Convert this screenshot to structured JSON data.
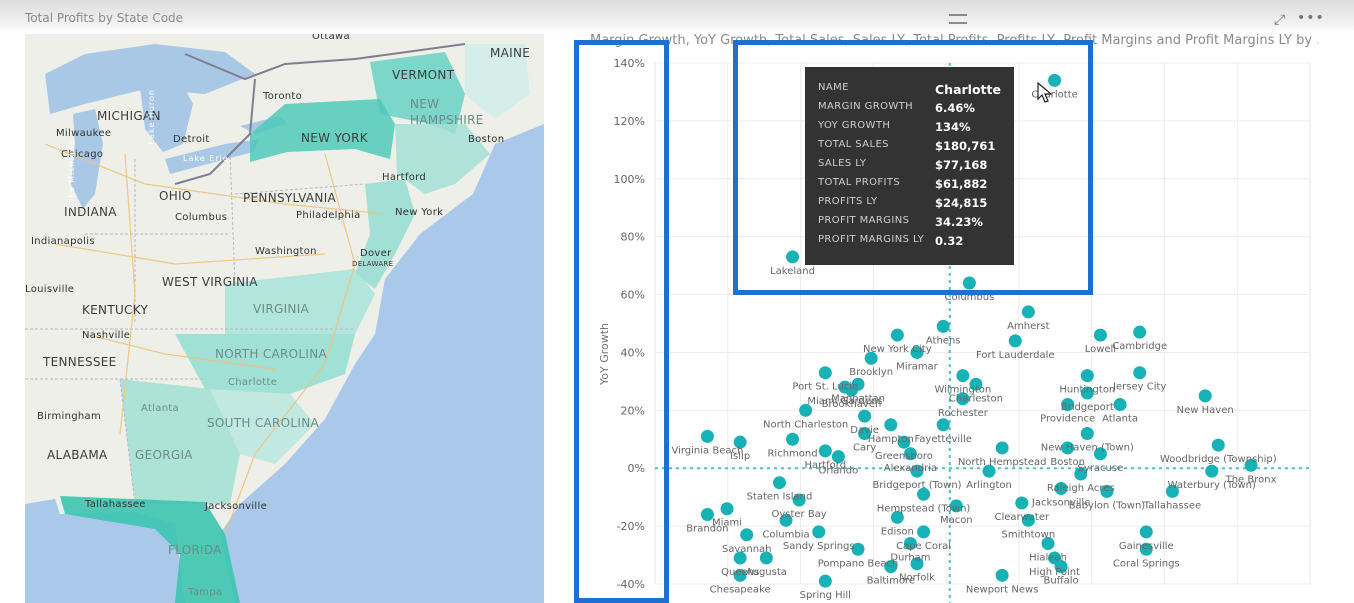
{
  "map": {
    "title": "Total Profits by State Code",
    "states": [
      "MAINE",
      "VERMONT",
      "NEW HAMPSHIRE",
      "NEW YORK",
      "MICHIGAN",
      "OHIO",
      "PENNSYLVANIA",
      "INDIANA",
      "KENTUCKY",
      "WEST VIRGINIA",
      "VIRGINIA",
      "NORTH CAROLINA",
      "TENNESSEE",
      "SOUTH CAROLINA",
      "GEORGIA",
      "ALABAMA",
      "FLORIDA"
    ],
    "cities": [
      "Ottawa",
      "Toronto",
      "Boston",
      "Milwaukee",
      "Detroit",
      "Chicago",
      "Hartford",
      "Columbus",
      "Philadelphia",
      "New York",
      "Indianapolis",
      "Washington",
      "Dover",
      "DELAWARE",
      "Nashville",
      "Charlotte",
      "Atlanta",
      "Birmingham",
      "Tallahassee",
      "Jacksonville",
      "Tampa",
      "Louisville"
    ],
    "lakes": [
      "Lake Michigan",
      "Lake Huron",
      "Lake Erie"
    ],
    "highlight_color": "#2ec4b6"
  },
  "chart": {
    "title": "Margin Growth, YoY Growth, Total Sales, Sales LY, Total Profits, Profits LY, Profit Margins and Profit Margins LY by ...",
    "ylabel": "YoY Growth",
    "icons": [
      "drag-handle-icon",
      "focus-mode-icon",
      "more-options-icon"
    ]
  },
  "chart_data": {
    "type": "scatter",
    "ylabel": "YoY Growth",
    "yticks": [
      "140%",
      "120%",
      "100%",
      "80%",
      "60%",
      "40%",
      "20%",
      "0%",
      "-20%",
      "-40%"
    ],
    "ylim": [
      -40,
      140
    ],
    "xlim": [
      0,
      100
    ],
    "point_color": "#17b2b6",
    "reference_lines": {
      "x": 45,
      "y": 0
    },
    "points": [
      {
        "label": "Charlotte",
        "x": 61,
        "y": 134
      },
      {
        "label": "Lakeland",
        "x": 21,
        "y": 73
      },
      {
        "label": "Columbus",
        "x": 48,
        "y": 64
      },
      {
        "label": "Amherst",
        "x": 57,
        "y": 54
      },
      {
        "label": "Lowell",
        "x": 68,
        "y": 46
      },
      {
        "label": "Cambridge",
        "x": 74,
        "y": 47
      },
      {
        "label": "New York City",
        "x": 37,
        "y": 46
      },
      {
        "label": "Athens",
        "x": 44,
        "y": 49
      },
      {
        "label": "Fort Lauderdale",
        "x": 55,
        "y": 44
      },
      {
        "label": "Port St. Lucie",
        "x": 26,
        "y": 33
      },
      {
        "label": "Brooklyn",
        "x": 33,
        "y": 38
      },
      {
        "label": "Miramar",
        "x": 40,
        "y": 40
      },
      {
        "label": "Wilmington",
        "x": 47,
        "y": 32
      },
      {
        "label": "Huntington",
        "x": 66,
        "y": 32
      },
      {
        "label": "Jersey City",
        "x": 74,
        "y": 33
      },
      {
        "label": "Miami Gardens",
        "x": 29,
        "y": 28
      },
      {
        "label": "Manhattan",
        "x": 31,
        "y": 29
      },
      {
        "label": "Charleston",
        "x": 49,
        "y": 29
      },
      {
        "label": "Bridgeport",
        "x": 66,
        "y": 26
      },
      {
        "label": "Brookhaven",
        "x": 30,
        "y": 27
      },
      {
        "label": "Rochester",
        "x": 47,
        "y": 24
      },
      {
        "label": "New Haven",
        "x": 84,
        "y": 25
      },
      {
        "label": "North Charleston",
        "x": 23,
        "y": 20
      },
      {
        "label": "Davie",
        "x": 32,
        "y": 18
      },
      {
        "label": "Providence",
        "x": 63,
        "y": 22
      },
      {
        "label": "Atlanta",
        "x": 71,
        "y": 22
      },
      {
        "label": "Hampton",
        "x": 36,
        "y": 15
      },
      {
        "label": "Fayetteville",
        "x": 44,
        "y": 15
      },
      {
        "label": "Virginia Beach",
        "x": 8,
        "y": 11
      },
      {
        "label": "Islip",
        "x": 13,
        "y": 9
      },
      {
        "label": "Richmond",
        "x": 21,
        "y": 10
      },
      {
        "label": "Cary",
        "x": 32,
        "y": 12
      },
      {
        "label": "Greensboro",
        "x": 38,
        "y": 9
      },
      {
        "label": "New Haven (Town)",
        "x": 66,
        "y": 12
      },
      {
        "label": "Woodbridge (Township)",
        "x": 86,
        "y": 8
      },
      {
        "label": "Hartford",
        "x": 26,
        "y": 6
      },
      {
        "label": "Orlando",
        "x": 28,
        "y": 4
      },
      {
        "label": "Alexandria",
        "x": 39,
        "y": 5
      },
      {
        "label": "North Hempstead",
        "x": 53,
        "y": 7
      },
      {
        "label": "Boston",
        "x": 63,
        "y": 7
      },
      {
        "label": "Syracuse",
        "x": 68,
        "y": 5
      },
      {
        "label": "Waterbury (Town)",
        "x": 85,
        "y": -1
      },
      {
        "label": "The Bronx",
        "x": 91,
        "y": 1
      },
      {
        "label": "Bridgeport (Town)",
        "x": 40,
        "y": -1
      },
      {
        "label": "Arlington",
        "x": 51,
        "y": -1
      },
      {
        "label": "Staten Island",
        "x": 19,
        "y": -5
      },
      {
        "label": "Raleigh Acres",
        "x": 65,
        "y": -2
      },
      {
        "label": "Jacksonville",
        "x": 62,
        "y": -7
      },
      {
        "label": "Tallahassee",
        "x": 79,
        "y": -8
      },
      {
        "label": "Miami",
        "x": 11,
        "y": -14
      },
      {
        "label": "Oyster Bay",
        "x": 22,
        "y": -11
      },
      {
        "label": "Hempstead (Town)",
        "x": 41,
        "y": -9
      },
      {
        "label": "Macon",
        "x": 46,
        "y": -13
      },
      {
        "label": "Clearwater",
        "x": 56,
        "y": -12
      },
      {
        "label": "Babylon (Town)",
        "x": 69,
        "y": -8
      },
      {
        "label": "Brandon",
        "x": 8,
        "y": -16
      },
      {
        "label": "Columbia",
        "x": 20,
        "y": -18
      },
      {
        "label": "Edison",
        "x": 37,
        "y": -17
      },
      {
        "label": "Smithtown",
        "x": 57,
        "y": -18
      },
      {
        "label": "Savannah",
        "x": 14,
        "y": -23
      },
      {
        "label": "Sandy Springs",
        "x": 25,
        "y": -22
      },
      {
        "label": "Cape Coral",
        "x": 41,
        "y": -22
      },
      {
        "label": "Gainesville",
        "x": 75,
        "y": -22
      },
      {
        "label": "Pompano Beach",
        "x": 31,
        "y": -28
      },
      {
        "label": "Durham",
        "x": 39,
        "y": -26
      },
      {
        "label": "Hialeah",
        "x": 60,
        "y": -26
      },
      {
        "label": "Queens",
        "x": 13,
        "y": -31
      },
      {
        "label": "Augusta",
        "x": 17,
        "y": -31
      },
      {
        "label": "Norfolk",
        "x": 40,
        "y": -33
      },
      {
        "label": "High Point",
        "x": 61,
        "y": -31
      },
      {
        "label": "Coral Springs",
        "x": 75,
        "y": -28
      },
      {
        "label": "Buffalo",
        "x": 62,
        "y": -34
      },
      {
        "label": "Chesapeake",
        "x": 13,
        "y": -37
      },
      {
        "label": "Baltimore",
        "x": 36,
        "y": -34
      },
      {
        "label": "Newport News",
        "x": 53,
        "y": -37
      },
      {
        "label": "Spring Hill",
        "x": 26,
        "y": -39
      }
    ]
  },
  "tooltip": {
    "rows": [
      {
        "key": "NAME",
        "value": "Charlotte"
      },
      {
        "key": "MARGIN GROWTH",
        "value": "6.46%"
      },
      {
        "key": "YOY GROWTH",
        "value": "134%"
      },
      {
        "key": "TOTAL SALES",
        "value": "$180,761"
      },
      {
        "key": "SALES LY",
        "value": "$77,168"
      },
      {
        "key": "TOTAL PROFITS",
        "value": "$61,882"
      },
      {
        "key": "PROFITS LY",
        "value": "$24,815"
      },
      {
        "key": "PROFIT MARGINS",
        "value": "34.23%"
      },
      {
        "key": "PROFIT MARGINS LY",
        "value": "0.32"
      }
    ]
  },
  "annotation_color": "#1f6fce"
}
